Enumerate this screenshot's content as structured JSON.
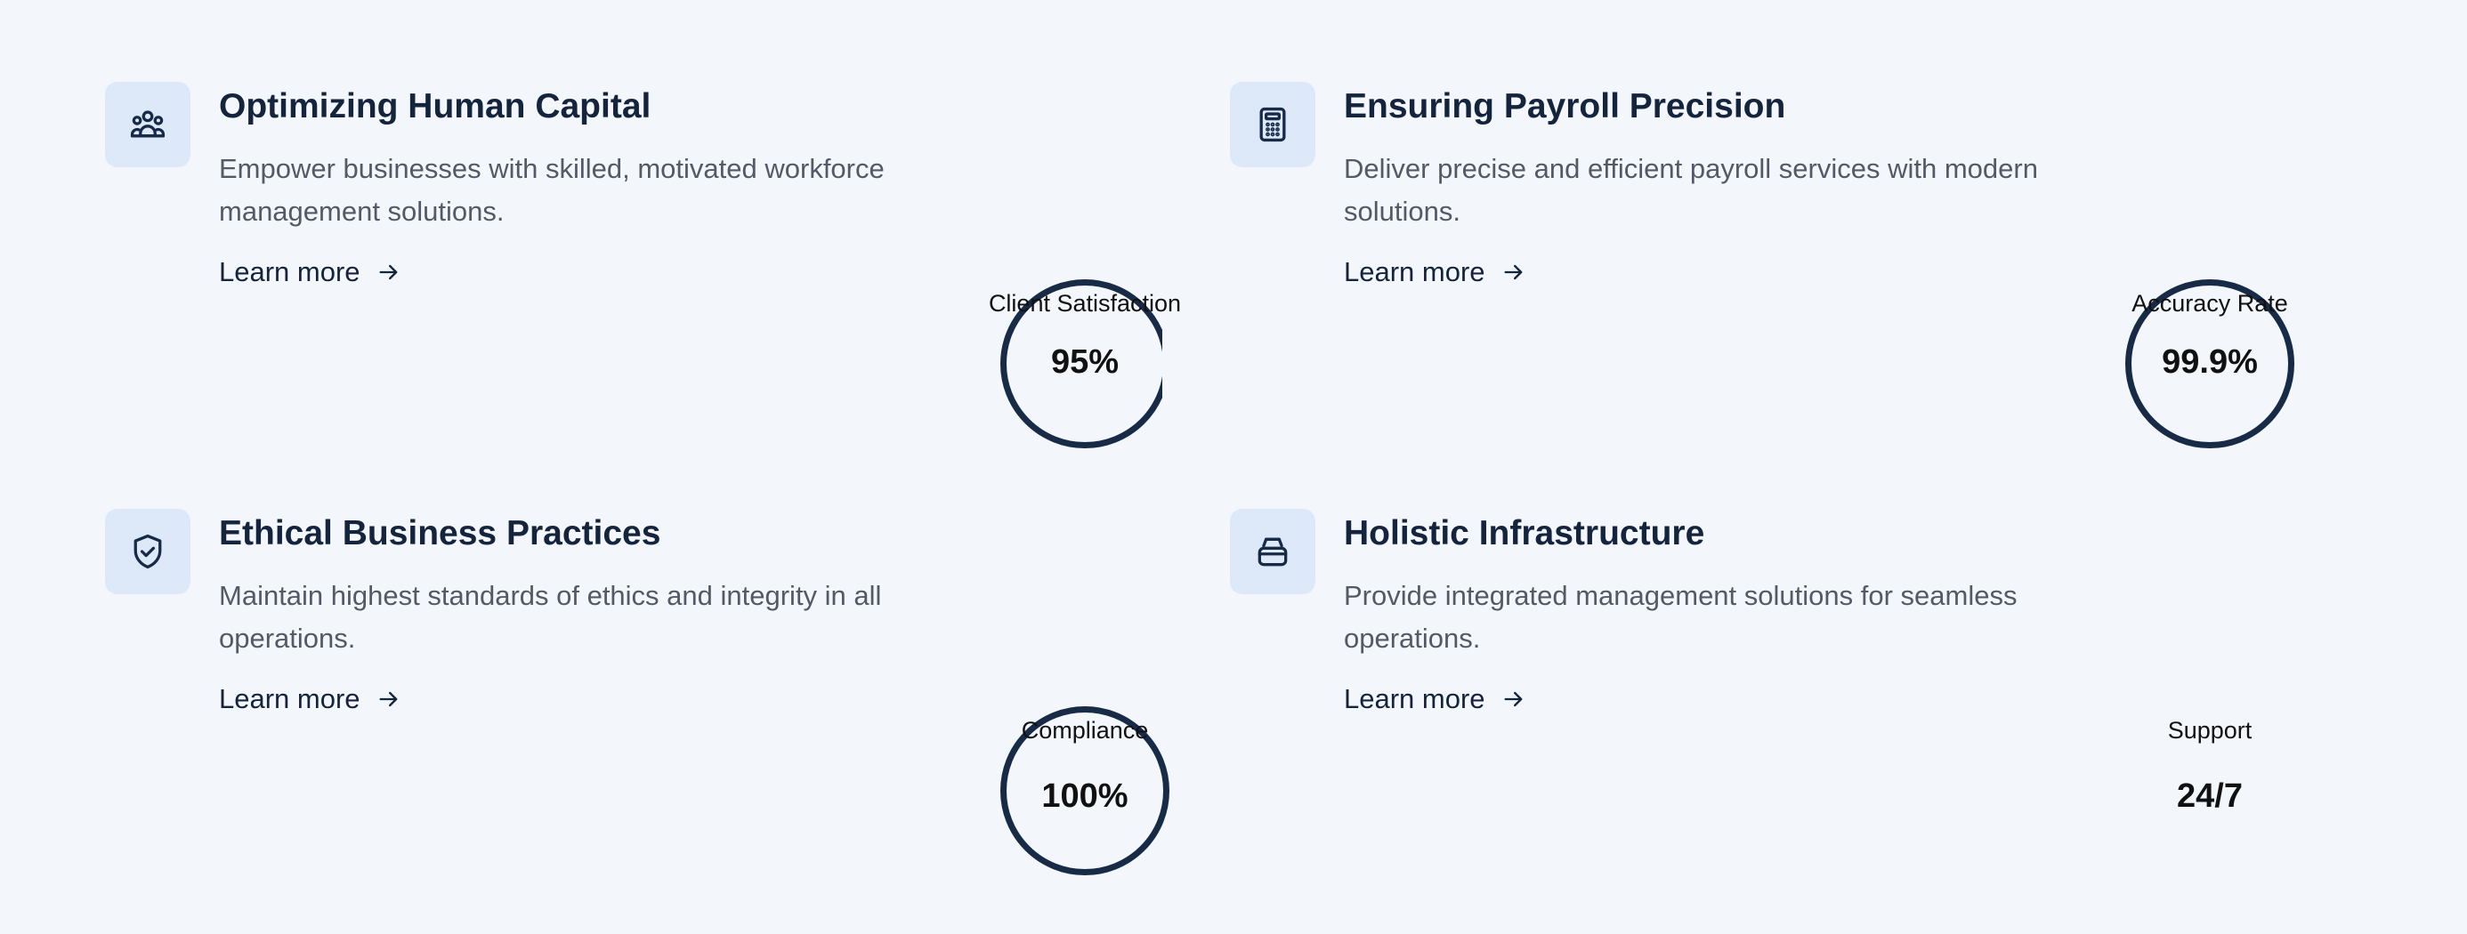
{
  "features": [
    {
      "icon": "users-group-icon",
      "title": "Optimizing Human Capital",
      "description": "Empower businesses with skilled, motivated workforce management solutions.",
      "link_label": "Learn more",
      "stat_label": "Client Satisfaction",
      "stat_value": "95%"
    },
    {
      "icon": "calculator-icon",
      "title": "Ensuring Payroll Precision",
      "description": "Deliver precise and efficient payroll services with modern solutions.",
      "link_label": "Learn more",
      "stat_label": "Accuracy Rate",
      "stat_value": "99.9%"
    },
    {
      "icon": "shield-check-icon",
      "title": "Ethical Business Practices",
      "description": "Maintain highest standards of ethics and integrity in all operations.",
      "link_label": "Learn more",
      "stat_label": "Compliance",
      "stat_value": "100%"
    },
    {
      "icon": "layers-stack-icon",
      "title": "Holistic Infrastructure",
      "description": "Provide integrated management solutions for seamless operations.",
      "link_label": "Learn more",
      "stat_label": "Support",
      "stat_value": "24/7"
    }
  ],
  "colors": {
    "background": "#f3f6fa",
    "icon_bg": "#dde8f9",
    "heading": "#14243d",
    "body_text": "#535a66",
    "ring": "#172a46"
  }
}
